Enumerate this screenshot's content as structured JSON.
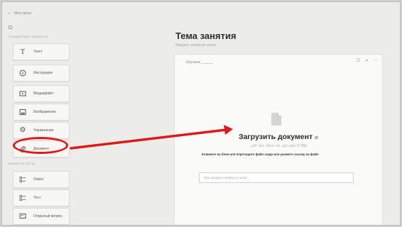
{
  "nav": {
    "back_label": "Мои уроки"
  },
  "sidebar": {
    "standard_section_label": "СТАНДАРТНЫЕ ЭЛЕМЕНТЫ",
    "standard_items": [
      {
        "label": "Текст",
        "icon": "text-icon"
      },
      {
        "label": "Инструкция",
        "icon": "info-icon"
      },
      {
        "label": "Медиафайл",
        "icon": "media-icon"
      },
      {
        "label": "Изображение",
        "icon": "image-icon"
      },
      {
        "label": "Упражнение",
        "icon": "gear-icon"
      },
      {
        "label": "Документ",
        "icon": "paperclip-icon"
      }
    ],
    "test_section_label": "ЭЛЕМЕНТЫ ТЕСТА",
    "test_items": [
      {
        "label": "Опрос",
        "icon": "list-icon"
      },
      {
        "label": "Тест",
        "icon": "list-icon"
      },
      {
        "label": "Открытый вопрос",
        "icon": "comment-icon"
      }
    ]
  },
  "main": {
    "title": "Тема занятия",
    "subtitle": "Введите описание урока",
    "card": {
      "header_text": "Изучаем ______",
      "upload_title": "Загрузить документ",
      "upload_formats": ".pdf .doc .docx .xls .ppt .pptx (5 Mb)",
      "upload_hint": "Кликните на блок или перетащите файл сюда или укажите ссылку на файл",
      "url_placeholder": "Или укажите прямую ссылку"
    }
  },
  "annotation": {
    "color": "#e01818"
  }
}
